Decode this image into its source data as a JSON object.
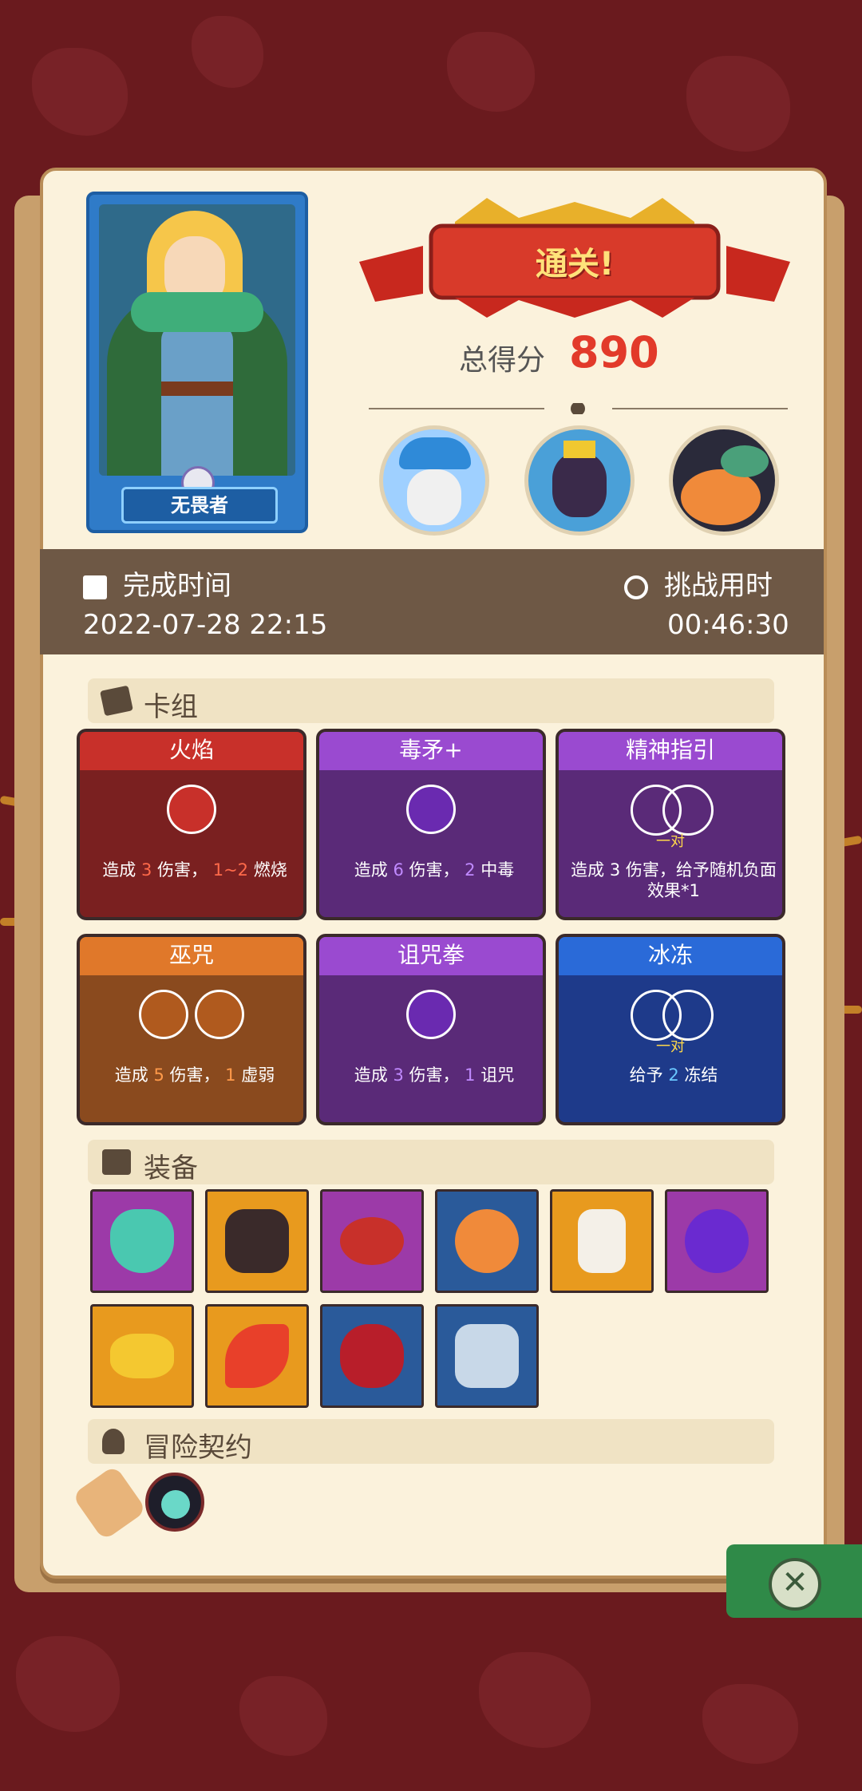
{
  "hero": {
    "name": "无畏者"
  },
  "result": {
    "banner": "通关!",
    "score_label": "总得分",
    "score": "890"
  },
  "bosses": [
    {
      "name": "mushroom-elder-icon",
      "color": "#9fd0ff"
    },
    {
      "name": "crowned-spider-icon",
      "color": "#4aa0d8"
    },
    {
      "name": "serpent-treasure-icon",
      "color": "#f08a3a"
    }
  ],
  "stats": {
    "finish_label": "完成时间",
    "finish_value": "2022-07-28 22:15",
    "duration_label": "挑战用时",
    "duration_value": "00:46:30"
  },
  "deck": {
    "title": "卡组",
    "cards": [
      {
        "title": "火焰",
        "desc1": "造成 ",
        "v1": "3",
        "desc2": " 伤害， ",
        "v2": "1~2",
        "desc3": " 燃烧",
        "label": ""
      },
      {
        "title": "毒矛+",
        "desc1": "造成 ",
        "v1": "6",
        "desc2": " 伤害， ",
        "v2": "2",
        "desc3": " 中毒",
        "label": ""
      },
      {
        "title": "精神指引",
        "desc1": "造成 ",
        "v1": "3",
        "desc2": " 伤害，给予随机负面效果*1",
        "v2": "",
        "desc3": "",
        "label": "一对"
      },
      {
        "title": "巫咒",
        "desc1": "造成 ",
        "v1": "5",
        "desc2": " 伤害， ",
        "v2": "1",
        "desc3": " 虚弱",
        "label": ""
      },
      {
        "title": "诅咒拳",
        "desc1": "造成 ",
        "v1": "3",
        "desc2": " 伤害， ",
        "v2": "1",
        "desc3": " 诅咒",
        "label": ""
      },
      {
        "title": "冰冻",
        "desc1": "给予 ",
        "v1": "2",
        "desc2": " 冻结",
        "v2": "",
        "desc3": "",
        "label": "一对"
      }
    ]
  },
  "equipment": {
    "title": "装备",
    "items": [
      {
        "name": "demon-shield-icon",
        "bg": "#9c3aa8"
      },
      {
        "name": "dark-armor-icon",
        "bg": "#e89a1e"
      },
      {
        "name": "ruby-bracelet-icon",
        "bg": "#9c3aa8"
      },
      {
        "name": "lightning-orb-icon",
        "bg": "#2a5a9a"
      },
      {
        "name": "jar-crystal-icon",
        "bg": "#e89a1e"
      },
      {
        "name": "purple-potion-icon",
        "bg": "#9c3aa8"
      },
      {
        "name": "golden-crown-icon",
        "bg": "#e89a1e"
      },
      {
        "name": "fire-feather-icon",
        "bg": "#e89a1e"
      },
      {
        "name": "horned-heart-icon",
        "bg": "#2a5a9a"
      },
      {
        "name": "compass-armor-icon",
        "bg": "#2a5a9a"
      }
    ]
  },
  "contract": {
    "title": "冒险契约"
  }
}
